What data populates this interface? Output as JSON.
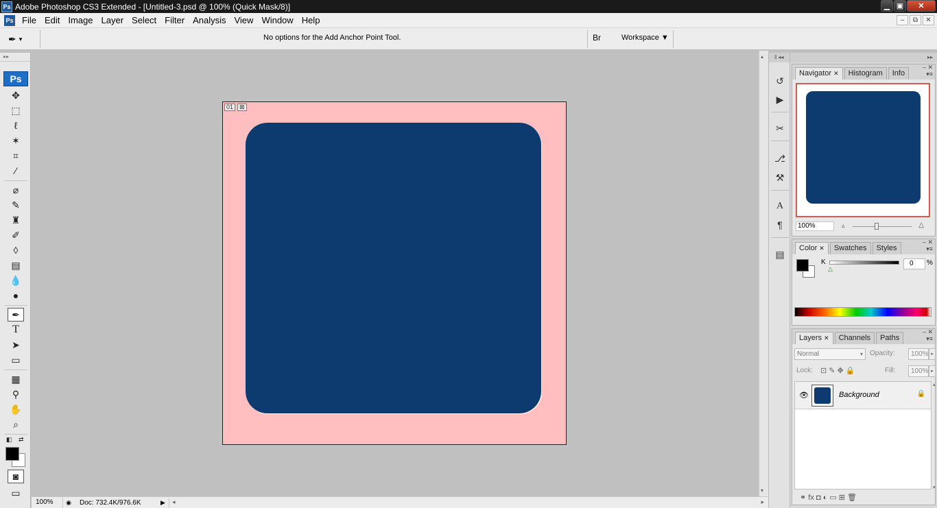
{
  "window": {
    "title": "Adobe Photoshop CS3 Extended - [Untitled-3.psd @ 100% (Quick Mask/8)]",
    "app_badge": "Ps",
    "min": "▁",
    "max": "▣",
    "close": "✕"
  },
  "menu": {
    "items": [
      "File",
      "Edit",
      "Image",
      "Layer",
      "Select",
      "Filter",
      "Analysis",
      "View",
      "Window",
      "Help"
    ],
    "doc_min": "–",
    "doc_restore": "⧉",
    "doc_close": "✕"
  },
  "options": {
    "tool_icon": "✒",
    "tool_dropdown": "▾",
    "message": "No options for the Add Anchor Point Tool.",
    "bridge_icon": "Br",
    "workspace_label": "Workspace ▼"
  },
  "toolbox": {
    "badge": "Ps",
    "grip": "▸▸",
    "tools": [
      {
        "name": "move-tool-icon",
        "glyph": "✥"
      },
      {
        "name": "marquee-tool-icon",
        "glyph": "⬚"
      },
      {
        "name": "lasso-tool-icon",
        "glyph": "ℓ"
      },
      {
        "name": "magic-wand-tool-icon",
        "glyph": "✶"
      },
      {
        "name": "crop-tool-icon",
        "glyph": "⌗"
      },
      {
        "name": "slice-tool-icon",
        "glyph": "∕"
      },
      {
        "name": "healing-brush-tool-icon",
        "glyph": "⌀"
      },
      {
        "name": "brush-tool-icon",
        "glyph": "✎"
      },
      {
        "name": "clone-stamp-tool-icon",
        "glyph": "♜"
      },
      {
        "name": "history-brush-tool-icon",
        "glyph": "✐"
      },
      {
        "name": "eraser-tool-icon",
        "glyph": "◊"
      },
      {
        "name": "gradient-tool-icon",
        "glyph": "▤"
      },
      {
        "name": "blur-tool-icon",
        "glyph": "💧"
      },
      {
        "name": "dodge-tool-icon",
        "glyph": "●"
      },
      {
        "name": "pen-tool-icon",
        "glyph": "✒"
      },
      {
        "name": "type-tool-icon",
        "glyph": "T"
      },
      {
        "name": "path-selection-tool-icon",
        "glyph": "➤"
      },
      {
        "name": "shape-tool-icon",
        "glyph": "▭"
      },
      {
        "name": "notes-tool-icon",
        "glyph": "▦"
      },
      {
        "name": "eyedropper-tool-icon",
        "glyph": "⚲"
      },
      {
        "name": "hand-tool-icon",
        "glyph": "✋"
      },
      {
        "name": "zoom-tool-icon",
        "glyph": "⌕"
      }
    ],
    "default_colors": "◧",
    "swap_colors": "⇄",
    "quick_mask": "◙",
    "screen_mode": "▭"
  },
  "document": {
    "tag_a": "01",
    "tag_b": "⊠",
    "mask_color": "#ffbfc0",
    "shape_color": "#0d3a6f"
  },
  "status": {
    "zoom": "100%",
    "icon": "◉",
    "doc": "Doc: 732.4K/976.6K",
    "arrow": "▶",
    "left": "◂",
    "right": "▸",
    "up": "▴",
    "down": "▾"
  },
  "dock": {
    "grip": "‖ ◂◂",
    "icons": [
      "history-icon",
      "actions-icon",
      "tool-presets-icon",
      "brushes-icon",
      "clone-source-icon",
      "character-icon",
      "paragraph-icon",
      "layer-comps-icon"
    ],
    "glyphs": [
      "↺",
      "▶",
      "✂",
      "⎇",
      "⚒",
      "A",
      "¶",
      "▤"
    ]
  },
  "panels": {
    "grip": "▸▸",
    "navigator": {
      "tabs": [
        "Navigator",
        "Histogram",
        "Info"
      ],
      "close_x": "✕",
      "zoom": "100%",
      "ctrls": "– ✕",
      "menu": "▾≡",
      "zoom_out": "▵",
      "zoom_in": "△"
    },
    "color": {
      "tabs": [
        "Color",
        "Swatches",
        "Styles"
      ],
      "close_x": "✕",
      "k_label": "K",
      "k_value": "0",
      "pct": "%",
      "marker": "△",
      "ctrls": "– ✕",
      "menu": "▾≡"
    },
    "layers": {
      "tabs": [
        "Layers",
        "Channels",
        "Paths"
      ],
      "close_x": "✕",
      "blend_mode": "Normal",
      "opacity_label": "Opacity:",
      "opacity_value": "100%",
      "lock_label": "Lock:",
      "lock_icons": "⊡ ✎ ✥ 🔒",
      "fill_label": "Fill:",
      "fill_value": "100%",
      "layer_name": "Background",
      "eye": "👁",
      "lock": "🔒",
      "footer": "⚭ fx ◘ ◐ ▭ ⊞ 🗑",
      "ctrls": "– ✕",
      "menu": "▾≡",
      "dd": "▾",
      "step": "▸",
      "scroll_up": "▴",
      "scroll_down": "▾"
    }
  }
}
